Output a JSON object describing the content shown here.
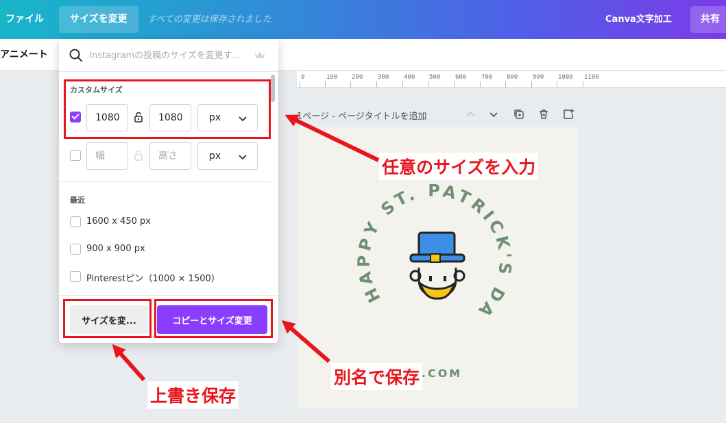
{
  "topbar": {
    "file_label": "ファイル",
    "resize_label": "サイズを変更",
    "saved_status": "すべての変更は保存されました",
    "doc_title": "Canva文字加工",
    "share_label": "共有"
  },
  "subbar": {
    "animate_label": "アニメート"
  },
  "ruler": {
    "ticks": [
      "0",
      "100",
      "200",
      "300",
      "400",
      "500",
      "600",
      "700",
      "800",
      "900",
      "1000",
      "1100"
    ]
  },
  "page": {
    "label": "1ページ - ページタイトルを追加",
    "icons": [
      "chevron-up-icon",
      "chevron-down-icon",
      "duplicate-icon",
      "trash-icon",
      "add-page-icon"
    ]
  },
  "design": {
    "circle_text": "HAPPY ST. PATRICK'S DAY",
    "watermark": "L.COM",
    "text_color": "#6e8f74",
    "hat_color": "#3d8ee5",
    "beard_color": "#f5c518"
  },
  "resize_panel": {
    "search_placeholder": "Instagramの投稿のサイズを変更す...",
    "custom_size_title": "カスタムサイズ",
    "custom_row": {
      "checked": true,
      "width": "1080",
      "height": "1080",
      "unit": "px"
    },
    "blank_row": {
      "checked": false,
      "width_placeholder": "幅",
      "height_placeholder": "高さ",
      "unit": "px"
    },
    "recent_title": "最近",
    "recent_items": [
      {
        "label": "1600 x 450 px"
      },
      {
        "label": "900 x 900 px"
      },
      {
        "label": "Pinterestピン（1000 × 1500）"
      }
    ],
    "resize_button": "サイズを変...",
    "copy_resize_button": "コピーとサイズ変更",
    "accent_color": "#8b3dff"
  },
  "annotations": {
    "input_size": "任意のサイズを入力",
    "overwrite_save": "上書き保存",
    "save_as": "別名で保存",
    "color": "#e8161c"
  }
}
